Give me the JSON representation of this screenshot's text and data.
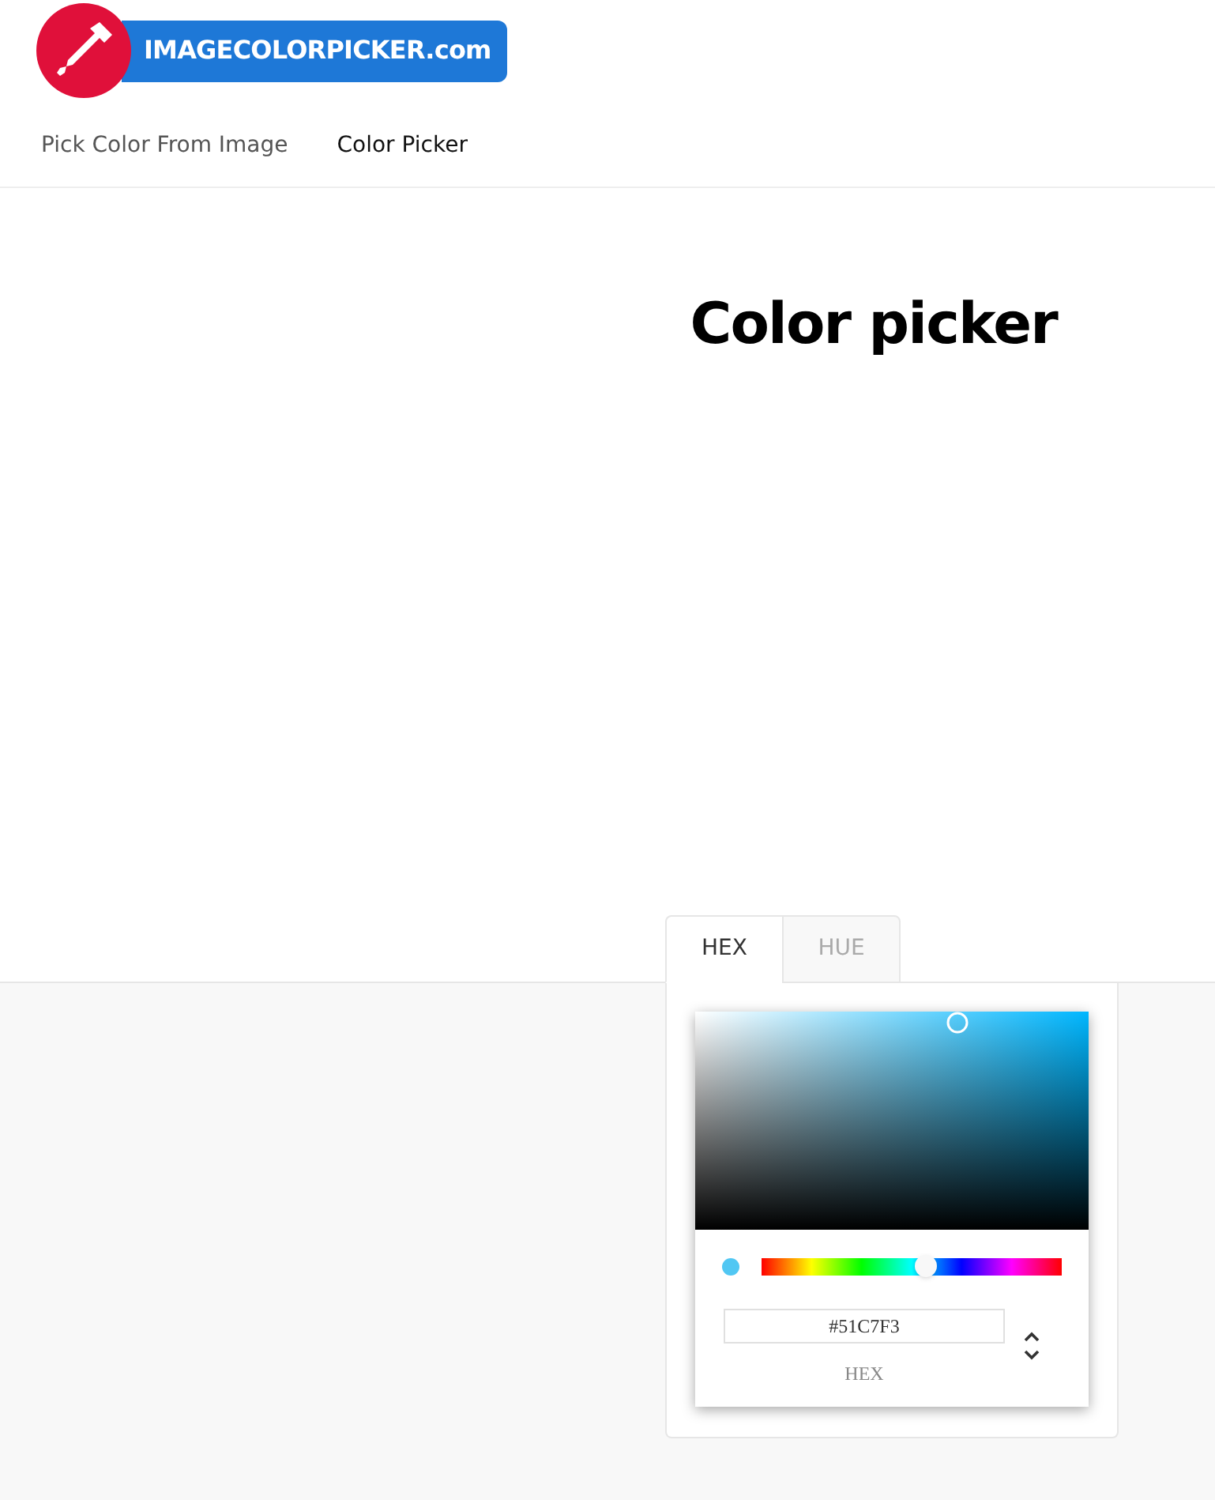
{
  "logo": {
    "text": "IMAGECOLORPICKER.com"
  },
  "nav": [
    {
      "label": "Pick Color From Image",
      "selected": false
    },
    {
      "label": "Color Picker",
      "selected": true
    }
  ],
  "heading": "Color picker",
  "tabs": [
    {
      "label": "HEX",
      "selected": true
    },
    {
      "label": "HUE",
      "selected": false
    }
  ],
  "picker": {
    "hue_slider": {
      "level": 0.547
    },
    "color": "#51c7f3",
    "value": "#51C7F3",
    "format_label": "HEX"
  }
}
